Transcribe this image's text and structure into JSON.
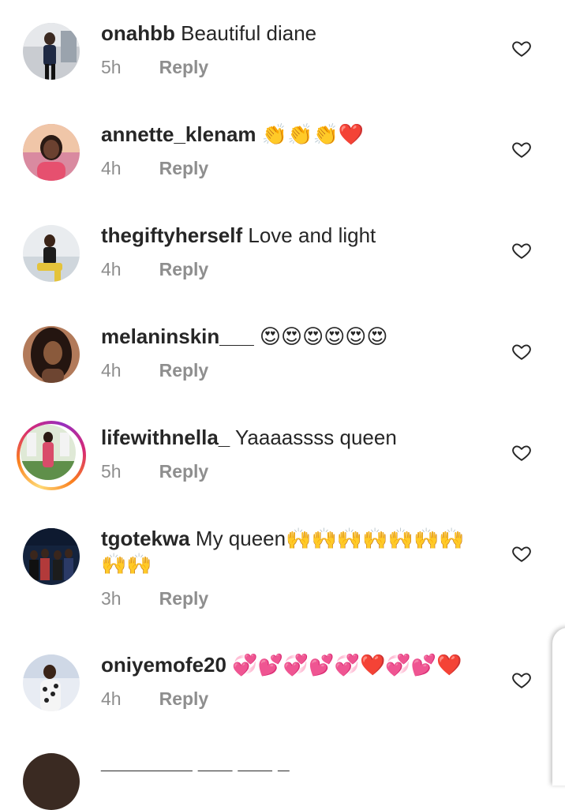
{
  "comments": [
    {
      "username": "onahbb",
      "text": " Beautiful diane",
      "time": "5h",
      "reply": "Reply"
    },
    {
      "username": "annette_klenam",
      "text": " 👏👏👏❤️",
      "time": "4h",
      "reply": "Reply"
    },
    {
      "username": "thegiftyherself",
      "text": " Love and light",
      "time": "4h",
      "reply": "Reply"
    },
    {
      "username": "melaninskin___",
      "text": " 😍😍😍😍😍😍",
      "time": "4h",
      "reply": "Reply"
    },
    {
      "username": "lifewithnella_",
      "text": " Yaaaassss queen",
      "time": "5h",
      "reply": "Reply"
    },
    {
      "username": "tgotekwa",
      "text": " My queen🙌🙌🙌🙌🙌🙌🙌🙌🙌",
      "time": "3h",
      "reply": "Reply"
    },
    {
      "username": "oniyemofe20",
      "text": " 💞💕💞💕💞❤️💞💕❤️",
      "time": "4h",
      "reply": "Reply"
    }
  ],
  "partial_comment_text": "________ ___ ___ _"
}
